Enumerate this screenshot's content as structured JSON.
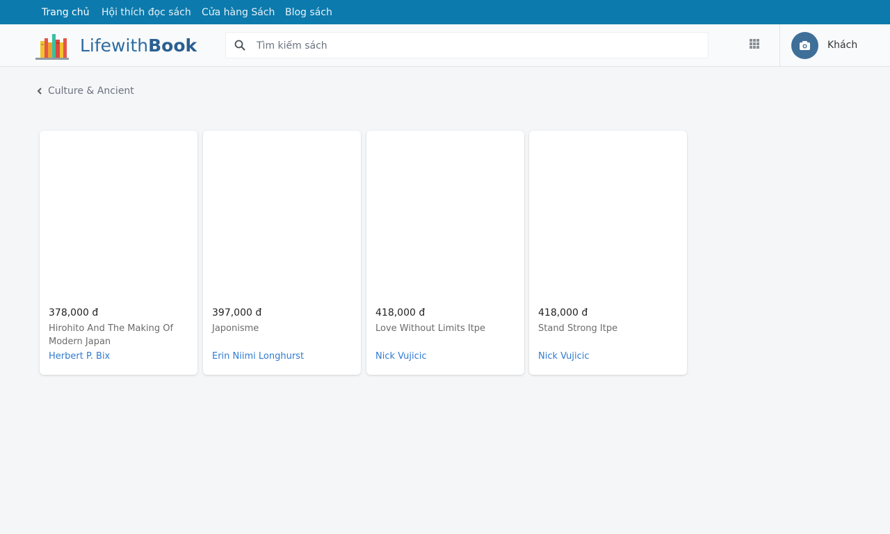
{
  "topnav": {
    "links": [
      {
        "label": "Trang chủ"
      },
      {
        "label": "Hội thích đọc sách"
      },
      {
        "label": "Cửa hàng Sách"
      },
      {
        "label": "Blog sách"
      }
    ]
  },
  "header": {
    "logo_prefix": "Lifewith",
    "logo_bold": "Book",
    "search_placeholder": "Tìm kiếm sách",
    "account_name": "Khách"
  },
  "breadcrumb": {
    "label": "Culture & Ancient"
  },
  "books": [
    {
      "price": "378,000 đ",
      "title": "Hirohito And The Making Of Modern Japan",
      "author": "Herbert P. Bix"
    },
    {
      "price": "397,000 đ",
      "title": "Japonisme",
      "author": "Erin Niimi Longhurst"
    },
    {
      "price": "418,000 đ",
      "title": "Love Without Limits Itpe",
      "author": "Nick Vujicic"
    },
    {
      "price": "418,000 đ",
      "title": "Stand Strong Itpe",
      "author": "Nick Vujicic"
    }
  ],
  "colors": {
    "topnav_bg": "#0d7aad",
    "brand": "#2d6ca2",
    "author_link": "#2f7ad1",
    "avatar_bg": "#3e6f99"
  },
  "icons": {
    "search": "search-icon",
    "apps": "grid-icon",
    "avatar": "camera-icon",
    "back": "chevron-left-icon",
    "logo": "bookshelf-logo-icon"
  }
}
